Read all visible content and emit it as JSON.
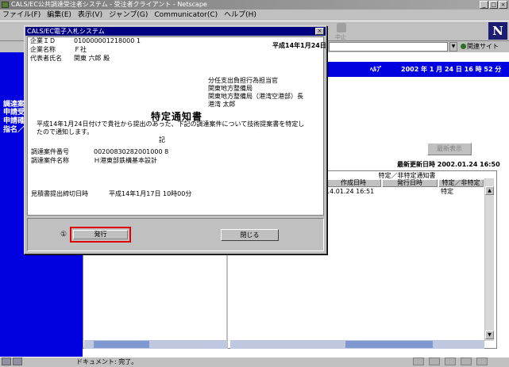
{
  "window": {
    "title": "CALS/EC公共調達受注者システム - 受注者クライアント - Netscape",
    "controls": [
      "_",
      "□",
      "×"
    ]
  },
  "menu": [
    "ファイル(F)",
    "編集(E)",
    "表示(V)",
    "ジャンプ(G)",
    "Communicator(C)",
    "ヘルプ(H)"
  ],
  "toolbar": {
    "stop_label": "中止",
    "logo": "N",
    "related_sites": "関連サイト"
  },
  "page": {
    "help_link": "ﾍﾙﾌﾟ",
    "datetime": "2002 年  1 月 24 日   16 時 52 分",
    "left_nav": [
      "調達案",
      "申請受",
      "申請確",
      "指名／"
    ],
    "refresh_button": "最新表示",
    "last_update": "最新更新日時 2002.01.24 16:50",
    "table": {
      "super_header": "特定／非特定通知書",
      "headers": [
        "作成日時",
        "発行日時",
        "特定／非特定"
      ],
      "rows": [
        [
          "14.01.24 16:51",
          "",
          "特定"
        ]
      ]
    }
  },
  "dialog": {
    "title": "CALS/EC電子入札システム",
    "close_glyph": "×",
    "company_id_label": "企業ＩＤ",
    "company_id": "010000001218000 1",
    "company_name_label": "企業名称",
    "company_name": "Ｆ社",
    "representative_label": "代表者氏名",
    "representative": "関東 六郎  殿",
    "date": "平成14年1月24日",
    "issuer_lines": [
      "分任支出負担行為担当官",
      "関東地方整備局",
      "関東地方整備局（港湾空港部）長",
      "港湾  太郎"
    ],
    "notice_title": "特定通知書",
    "notice_body": "平成14年1月24日付けで貴社から提出のあった、下記の調達案件について技術提案書を特定したので通知します。",
    "ki": "記",
    "case_number_label": "調達案件番号",
    "case_number": "00200830282001000 8",
    "case_name_label": "調達案件名称",
    "case_name": "Ｈ港東部鉄構基本設計",
    "deadline_label": "見積書提出締切日時",
    "deadline": "平成14年1月17日  10時00分",
    "circle_number": "①",
    "issue_button": "発行",
    "close_button": "閉じる"
  },
  "status": {
    "text": "ドキュメント: 完了。"
  }
}
